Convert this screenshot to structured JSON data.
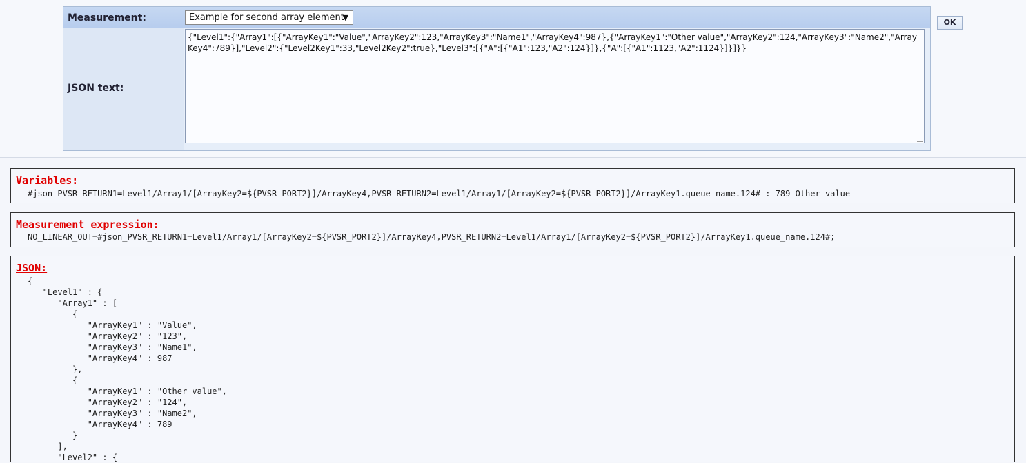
{
  "form": {
    "measurement_label": "Measurement:",
    "measurement_select_value": "Example for second array element",
    "json_text_label": "JSON text:",
    "json_text_value": "{\"Level1\":{\"Array1\":[{\"ArrayKey1\":\"Value\",\"ArrayKey2\":123,\"ArrayKey3\":\"Name1\",\"ArrayKey4\":987},{\"ArrayKey1\":\"Other value\",\"ArrayKey2\":124,\"ArrayKey3\":\"Name2\",\"ArrayKey4\":789}],\"Level2\":{\"Level2Key1\":33,\"Level2Key2\":true},\"Level3\":[{\"A\":[{\"A1\":123,\"A2\":124}]},{\"A\":[{\"A1\":1123,\"A2\":1124}]}]}}",
    "ok_label": "OK"
  },
  "variables": {
    "title": "Variables:",
    "text": "#json_PVSR_RETURN1=Level1/Array1/[ArrayKey2=${PVSR_PORT2}]/ArrayKey4,PVSR_RETURN2=Level1/Array1/[ArrayKey2=${PVSR_PORT2}]/ArrayKey1.queue_name.124# : 789 Other value"
  },
  "measurement_expression": {
    "title": "Measurement expression:",
    "text": "NO_LINEAR_OUT=#json_PVSR_RETURN1=Level1/Array1/[ArrayKey2=${PVSR_PORT2}]/ArrayKey4,PVSR_RETURN2=Level1/Array1/[ArrayKey2=${PVSR_PORT2}]/ArrayKey1.queue_name.124#;"
  },
  "json_output": {
    "title": "JSON:",
    "text": "{\n   \"Level1\" : {\n      \"Array1\" : [\n         {\n            \"ArrayKey1\" : \"Value\",\n            \"ArrayKey2\" : \"123\",\n            \"ArrayKey3\" : \"Name1\",\n            \"ArrayKey4\" : 987\n         },\n         {\n            \"ArrayKey1\" : \"Other value\",\n            \"ArrayKey2\" : \"124\",\n            \"ArrayKey3\" : \"Name2\",\n            \"ArrayKey4\" : 789\n         }\n      ],\n      \"Level2\" : {"
  },
  "icons": {
    "select_arrow": "dropdown-arrow-icon",
    "resize": "resize-grip-icon"
  },
  "colors": {
    "title_red": "#e00000",
    "panel_header": "#b7cdee",
    "panel_body": "#dde7f5"
  }
}
